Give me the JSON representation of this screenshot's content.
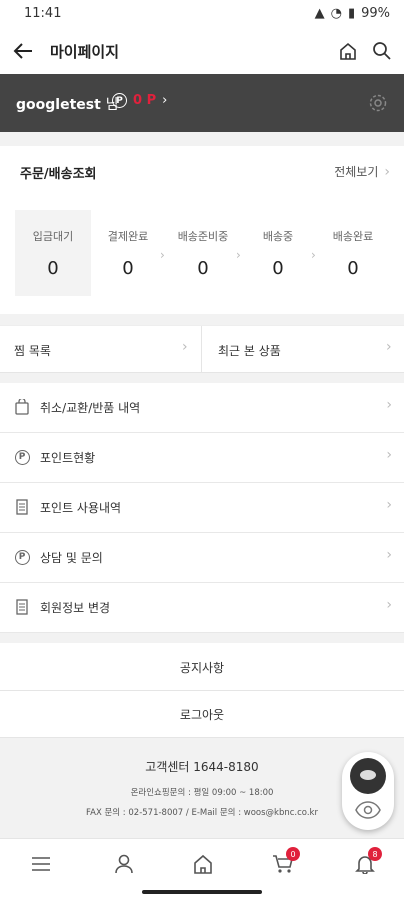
{
  "status_bar": {
    "time": "11:41",
    "battery": "99%"
  },
  "header": {
    "title": "마이페이지"
  },
  "user": {
    "name": "googletest",
    "suffix": "님",
    "points": "0 P"
  },
  "orders": {
    "title": "주문/배송조회",
    "view_all": "전체보기",
    "steps": [
      {
        "label": "입금대기",
        "count": "0"
      },
      {
        "label": "결제완료",
        "count": "0"
      },
      {
        "label": "배송준비중",
        "count": "0"
      },
      {
        "label": "배송중",
        "count": "0"
      },
      {
        "label": "배송완료",
        "count": "0"
      }
    ]
  },
  "quick": {
    "wishlist": "찜 목록",
    "recent": "최근 본 상품"
  },
  "menu": [
    {
      "label": "취소/교환/반품 내역",
      "icon": "bag-icon"
    },
    {
      "label": "포인트현황",
      "icon": "point-circle-icon"
    },
    {
      "label": "포인트 사용내역",
      "icon": "document-icon"
    },
    {
      "label": "상담 및 문의",
      "icon": "point-circle-icon"
    },
    {
      "label": "회원정보 변경",
      "icon": "document-icon"
    }
  ],
  "links": {
    "notice": "공지사항",
    "logout": "로그아웃"
  },
  "footer": {
    "customer_center": "고객센터 1644-8180",
    "hours": "온라인쇼핑문의 : 평일 09:00 ~ 18:00",
    "contact": "FAX 문의 : 02-571-8007 / E-Mail 문의 : woos@kbnc.co.kr"
  },
  "nav": {
    "cart_badge": "0",
    "bell_badge": "8"
  },
  "colors": {
    "accent": "#e0213c",
    "band": "#444444"
  }
}
